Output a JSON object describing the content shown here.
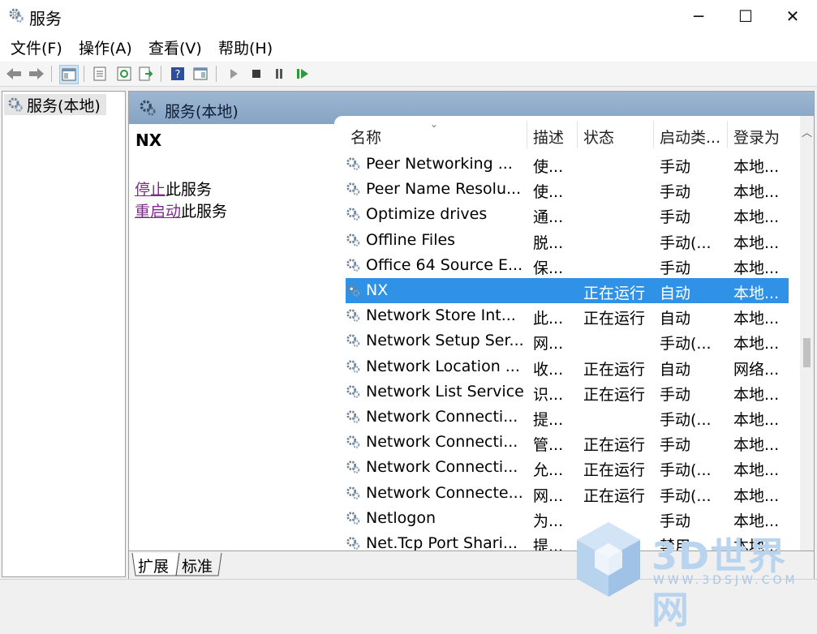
{
  "window": {
    "title": "服务",
    "minimize": "─",
    "maximize": "☐",
    "close": "✕"
  },
  "menu": [
    "文件(F)",
    "操作(A)",
    "查看(V)",
    "帮助(H)"
  ],
  "tree": {
    "root_label": "服务(本地)"
  },
  "main": {
    "header_title": "服务(本地)",
    "selected_service": "NX",
    "stop_link": "停止",
    "stop_suffix": "此服务",
    "restart_link": "重启动",
    "restart_suffix": "此服务"
  },
  "columns": [
    "名称",
    "描述",
    "状态",
    "启动类...",
    "登录为"
  ],
  "sort_indicator": "⌄",
  "rows": [
    {
      "name": "Peer Networking ...",
      "desc": "使...",
      "status": "",
      "startup": "手动",
      "logon": "本地...",
      "selected": false
    },
    {
      "name": "Peer Name Resolu...",
      "desc": "使...",
      "status": "",
      "startup": "手动",
      "logon": "本地...",
      "selected": false
    },
    {
      "name": "Optimize drives",
      "desc": "通...",
      "status": "",
      "startup": "手动",
      "logon": "本地...",
      "selected": false
    },
    {
      "name": "Offline Files",
      "desc": "脱...",
      "status": "",
      "startup": "手动(...",
      "logon": "本地...",
      "selected": false
    },
    {
      "name": "Office 64 Source E...",
      "desc": "保...",
      "status": "",
      "startup": "手动",
      "logon": "本地...",
      "selected": false
    },
    {
      "name": "NX",
      "desc": "",
      "status": "正在运行",
      "startup": "自动",
      "logon": "本地...",
      "selected": true
    },
    {
      "name": "Network Store Int...",
      "desc": "此...",
      "status": "正在运行",
      "startup": "自动",
      "logon": "本地...",
      "selected": false
    },
    {
      "name": "Network Setup Ser...",
      "desc": "网...",
      "status": "",
      "startup": "手动(...",
      "logon": "本地...",
      "selected": false
    },
    {
      "name": "Network Location ...",
      "desc": "收...",
      "status": "正在运行",
      "startup": "自动",
      "logon": "网络...",
      "selected": false
    },
    {
      "name": "Network List Service",
      "desc": "识...",
      "status": "正在运行",
      "startup": "手动",
      "logon": "本地...",
      "selected": false
    },
    {
      "name": "Network Connecti...",
      "desc": "提...",
      "status": "",
      "startup": "手动(...",
      "logon": "本地...",
      "selected": false
    },
    {
      "name": "Network Connecti...",
      "desc": "管...",
      "status": "正在运行",
      "startup": "手动",
      "logon": "本地...",
      "selected": false
    },
    {
      "name": "Network Connecti...",
      "desc": "允...",
      "status": "正在运行",
      "startup": "手动(...",
      "logon": "本地...",
      "selected": false
    },
    {
      "name": "Network Connecte...",
      "desc": "网...",
      "status": "正在运行",
      "startup": "手动(...",
      "logon": "本地...",
      "selected": false
    },
    {
      "name": "Netlogon",
      "desc": "为...",
      "status": "",
      "startup": "手动",
      "logon": "本地...",
      "selected": false
    },
    {
      "name": "Net.Tcp Port Shari...",
      "desc": "提...",
      "status": "",
      "startup": "禁用",
      "logon": "本地...",
      "selected": false
    }
  ],
  "tabs": [
    "扩展",
    "标准"
  ],
  "watermark": {
    "text": "3D世界网",
    "url": "WWW.3DSJW.COM"
  },
  "colors": {
    "selection": "#3092e6",
    "header_gradient": "#9db7d2",
    "link": "#7d2b8b"
  }
}
